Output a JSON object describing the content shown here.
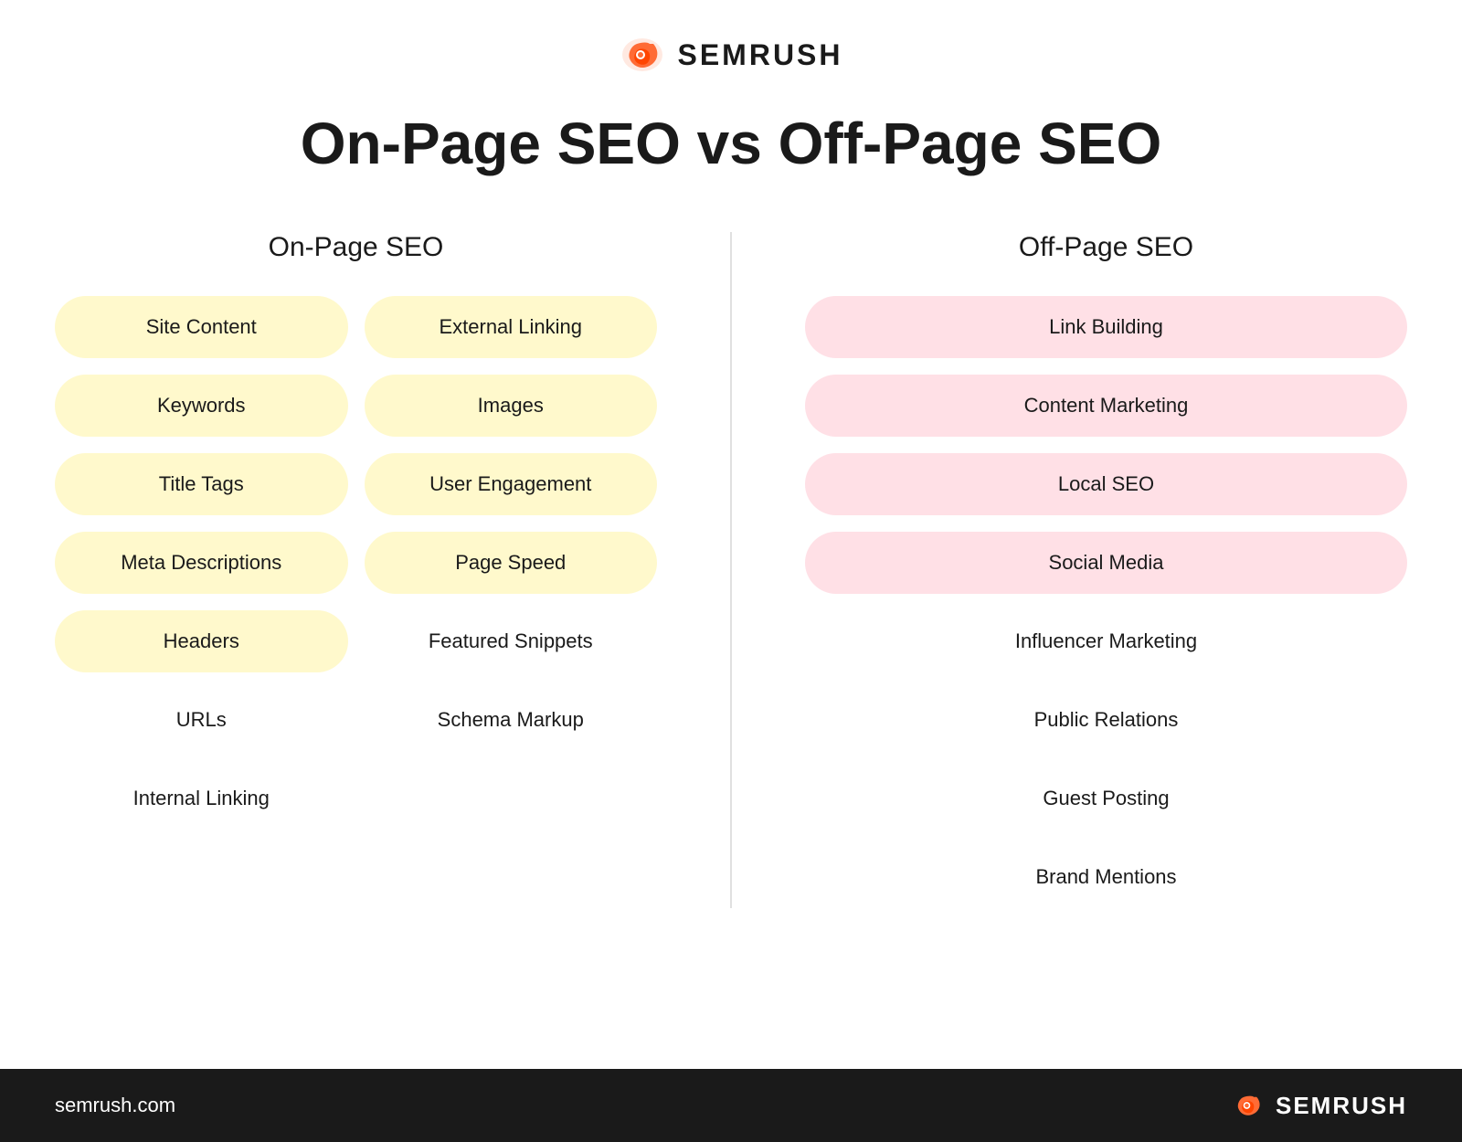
{
  "header": {
    "logo_text": "SEMRUSH"
  },
  "title": "On-Page SEO vs Off-Page SEO",
  "onpage": {
    "column_title": "On-Page SEO",
    "col1": [
      {
        "label": "Site Content",
        "style": "yellow"
      },
      {
        "label": "Keywords",
        "style": "yellow"
      },
      {
        "label": "Title Tags",
        "style": "yellow"
      },
      {
        "label": "Meta Descriptions",
        "style": "yellow"
      },
      {
        "label": "Headers",
        "style": "yellow"
      },
      {
        "label": "URLs",
        "style": "plain"
      },
      {
        "label": "Internal Linking",
        "style": "plain"
      }
    ],
    "col2": [
      {
        "label": "External Linking",
        "style": "yellow"
      },
      {
        "label": "Images",
        "style": "yellow"
      },
      {
        "label": "User Engagement",
        "style": "yellow"
      },
      {
        "label": "Page Speed",
        "style": "yellow"
      },
      {
        "label": "Featured Snippets",
        "style": "plain"
      },
      {
        "label": "Schema Markup",
        "style": "plain"
      }
    ]
  },
  "offpage": {
    "column_title": "Off-Page SEO",
    "items": [
      {
        "label": "Link Building",
        "style": "pink"
      },
      {
        "label": "Content Marketing",
        "style": "pink"
      },
      {
        "label": "Local SEO",
        "style": "pink"
      },
      {
        "label": "Social Media",
        "style": "pink"
      },
      {
        "label": "Influencer Marketing",
        "style": "plain"
      },
      {
        "label": "Public Relations",
        "style": "plain"
      },
      {
        "label": "Guest Posting",
        "style": "plain"
      },
      {
        "label": "Brand Mentions",
        "style": "plain"
      }
    ]
  },
  "footer": {
    "url": "semrush.com",
    "logo_text": "SEMRUSH"
  }
}
